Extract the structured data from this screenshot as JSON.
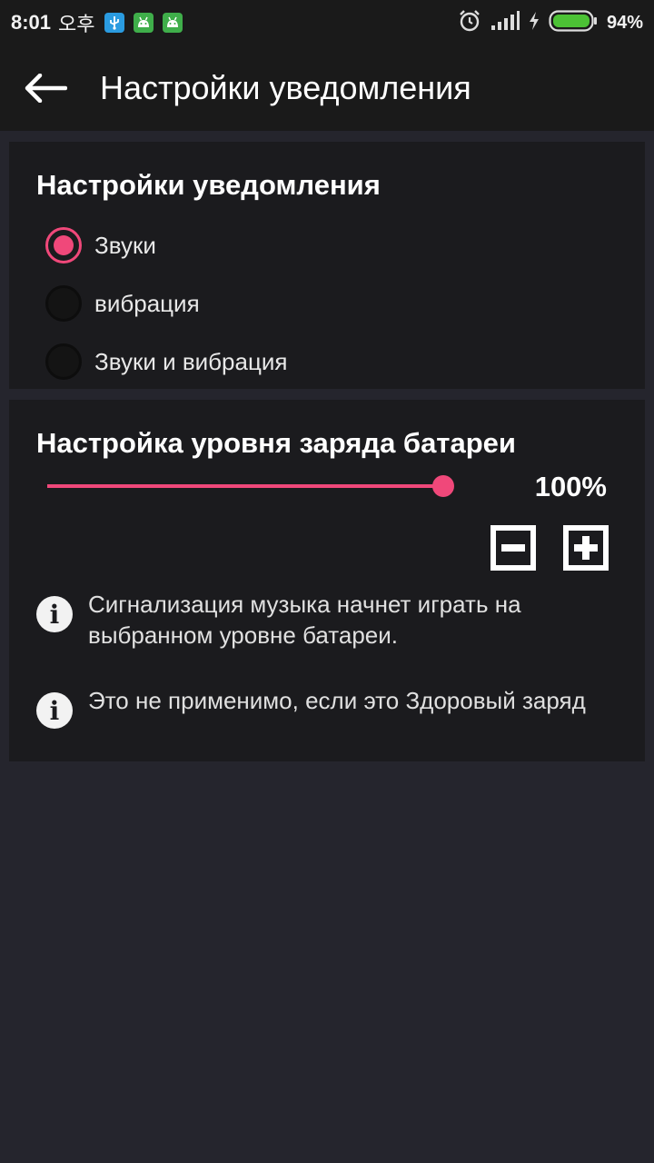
{
  "status_bar": {
    "time": "8:01",
    "ampm": "오후",
    "battery_pct": "94%",
    "notif_icons": [
      "usb-icon",
      "android-icon",
      "android-icon"
    ]
  },
  "toolbar": {
    "title": "Настройки уведомления"
  },
  "notification_settings": {
    "title": "Настройки уведомления",
    "options": [
      {
        "label": "Звуки",
        "checked": true
      },
      {
        "label": "вибрация",
        "checked": false
      },
      {
        "label": "Звуки и вибрация",
        "checked": false
      }
    ]
  },
  "battery_settings": {
    "title": "Настройка уровня заряда батареи",
    "level_percent": 100,
    "level_label": "100%",
    "info": [
      "Сигнализация музыка начнет играть на выбранном уровне батареи.",
      "Это не применимо, если это Здоровый заряд"
    ]
  },
  "colors": {
    "accent": "#f0487a",
    "background": "#25252d",
    "card": "#1b1b1e",
    "bar": "#1a1a1a"
  }
}
